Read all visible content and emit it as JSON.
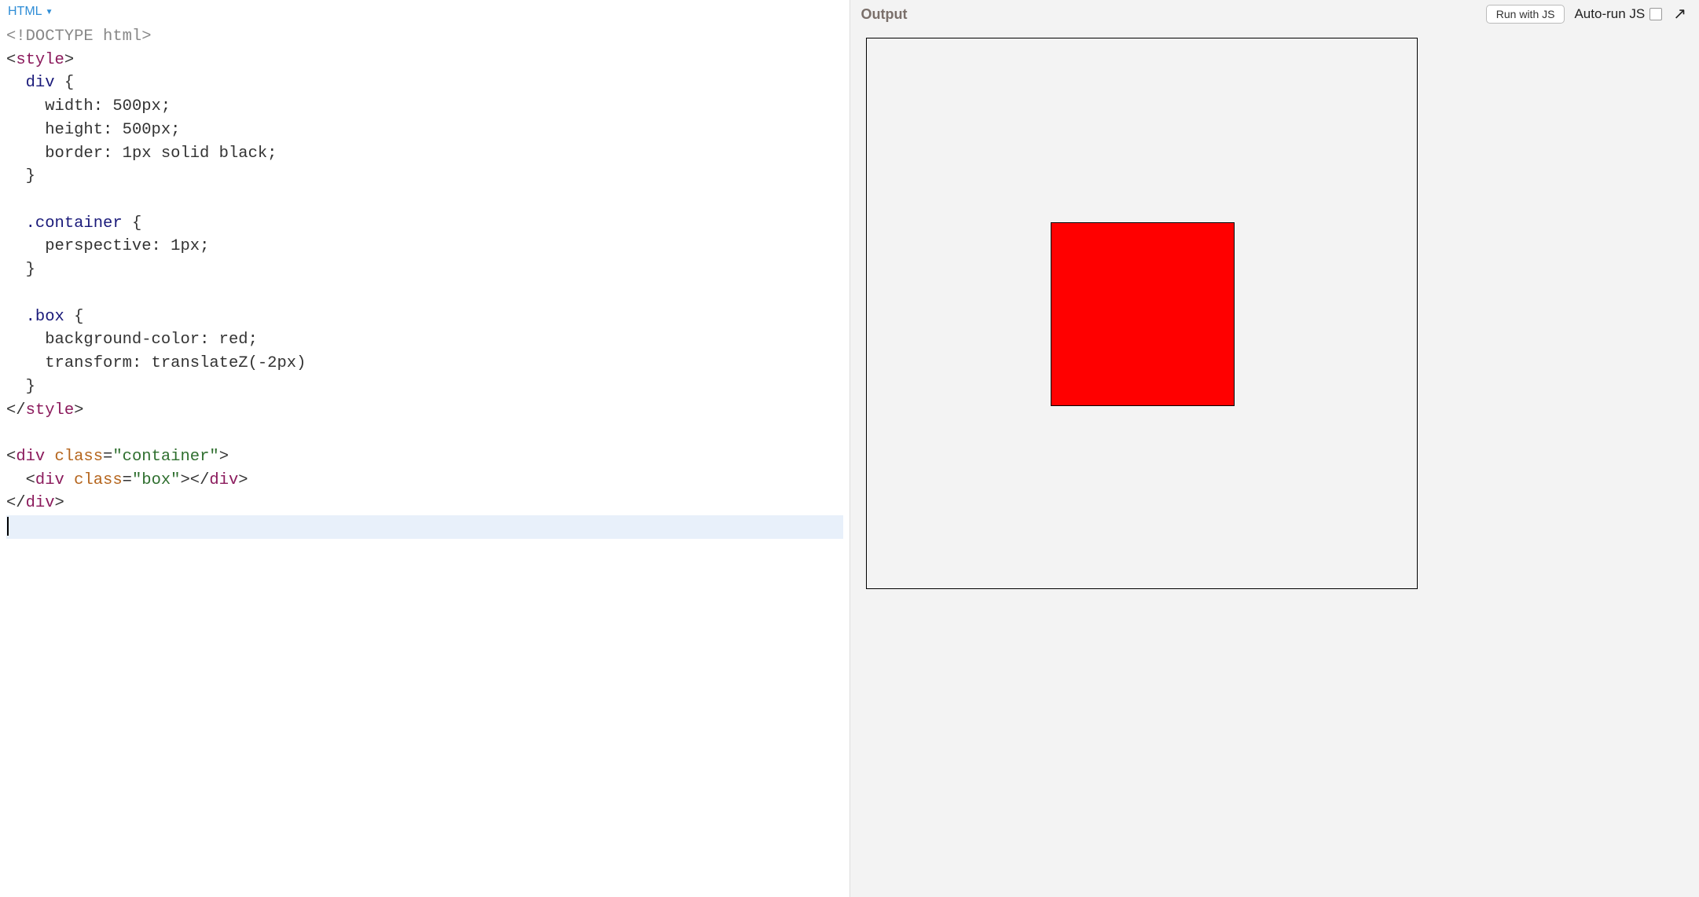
{
  "editor": {
    "language_label": "HTML",
    "code_lines": [
      {
        "type": "doctype",
        "text": "<!DOCTYPE html>"
      },
      {
        "type": "tag-open",
        "tag": "style"
      },
      {
        "type": "css",
        "indent": 2,
        "selector": "div",
        "brace": " {"
      },
      {
        "type": "css-decl",
        "indent": 4,
        "prop": "width",
        "value": "500px",
        "term": ";"
      },
      {
        "type": "css-decl",
        "indent": 4,
        "prop": "height",
        "value": "500px",
        "term": ";"
      },
      {
        "type": "css-decl",
        "indent": 4,
        "prop": "border",
        "value": "1px solid black",
        "term": ";"
      },
      {
        "type": "css-close",
        "indent": 2
      },
      {
        "type": "blank"
      },
      {
        "type": "css",
        "indent": 2,
        "selector": ".container",
        "brace": " {"
      },
      {
        "type": "css-decl",
        "indent": 4,
        "prop": "perspective",
        "value": "1px",
        "term": ";"
      },
      {
        "type": "css-close",
        "indent": 2
      },
      {
        "type": "blank"
      },
      {
        "type": "css",
        "indent": 2,
        "selector": ".box",
        "brace": " {"
      },
      {
        "type": "css-decl",
        "indent": 4,
        "prop": "background-color",
        "value": "red",
        "term": ";"
      },
      {
        "type": "css-decl",
        "indent": 4,
        "prop": "transform",
        "value": "translateZ(-2px)",
        "term": ""
      },
      {
        "type": "css-close",
        "indent": 2
      },
      {
        "type": "tag-close",
        "tag": "style"
      },
      {
        "type": "blank"
      },
      {
        "type": "html-open",
        "indent": 0,
        "tag": "div",
        "attrs": [
          {
            "name": "class",
            "value": "container"
          }
        ]
      },
      {
        "type": "html-open-close",
        "indent": 2,
        "tag": "div",
        "attrs": [
          {
            "name": "class",
            "value": "box"
          }
        ]
      },
      {
        "type": "html-close",
        "indent": 0,
        "tag": "div"
      },
      {
        "type": "cursor"
      }
    ]
  },
  "output": {
    "title": "Output",
    "run_button_label": "Run with JS",
    "autorun_label": "Auto-run JS"
  },
  "preview": {
    "container_border_color": "#000000",
    "box_color": "red"
  }
}
